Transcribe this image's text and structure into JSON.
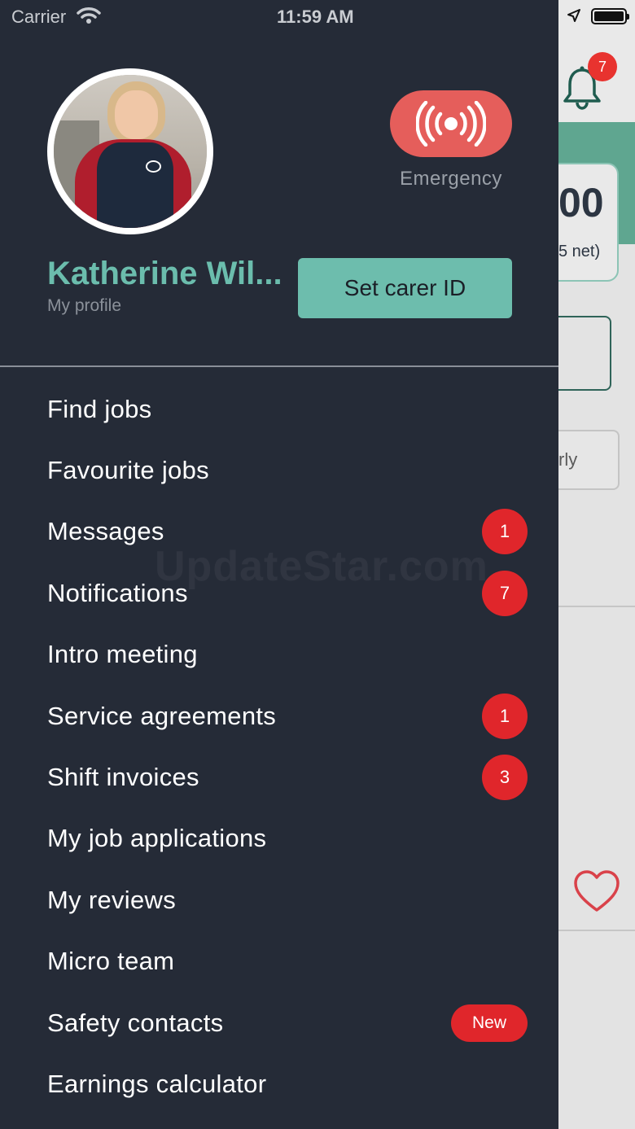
{
  "status_bar": {
    "carrier": "Carrier",
    "time": "11:59 AM"
  },
  "background_app": {
    "bell_badge": "7",
    "card_amount": "00",
    "card_net": "5 net)",
    "pill_text": "rly"
  },
  "profile": {
    "name": "Katherine Wil...",
    "link": "My profile"
  },
  "emergency": {
    "label": "Emergency"
  },
  "carer_id": {
    "label": "Set carer ID"
  },
  "menu": {
    "items": [
      {
        "label": "Find jobs"
      },
      {
        "label": "Favourite jobs"
      },
      {
        "label": "Messages",
        "badge": "1"
      },
      {
        "label": "Notifications",
        "badge": "7"
      },
      {
        "label": "Intro meeting"
      },
      {
        "label": "Service agreements",
        "badge": "1"
      },
      {
        "label": "Shift invoices",
        "badge": "3"
      },
      {
        "label": "My job applications"
      },
      {
        "label": "My reviews"
      },
      {
        "label": "Micro team"
      },
      {
        "label": "Safety contacts",
        "tag": "New"
      },
      {
        "label": "Earnings calculator"
      }
    ]
  },
  "watermark": "UpdateStar.com",
  "colors": {
    "drawer_bg": "#252b37",
    "accent_teal": "#6dbdad",
    "emergency_red": "#e55e5b",
    "badge_red": "#e0262b"
  }
}
